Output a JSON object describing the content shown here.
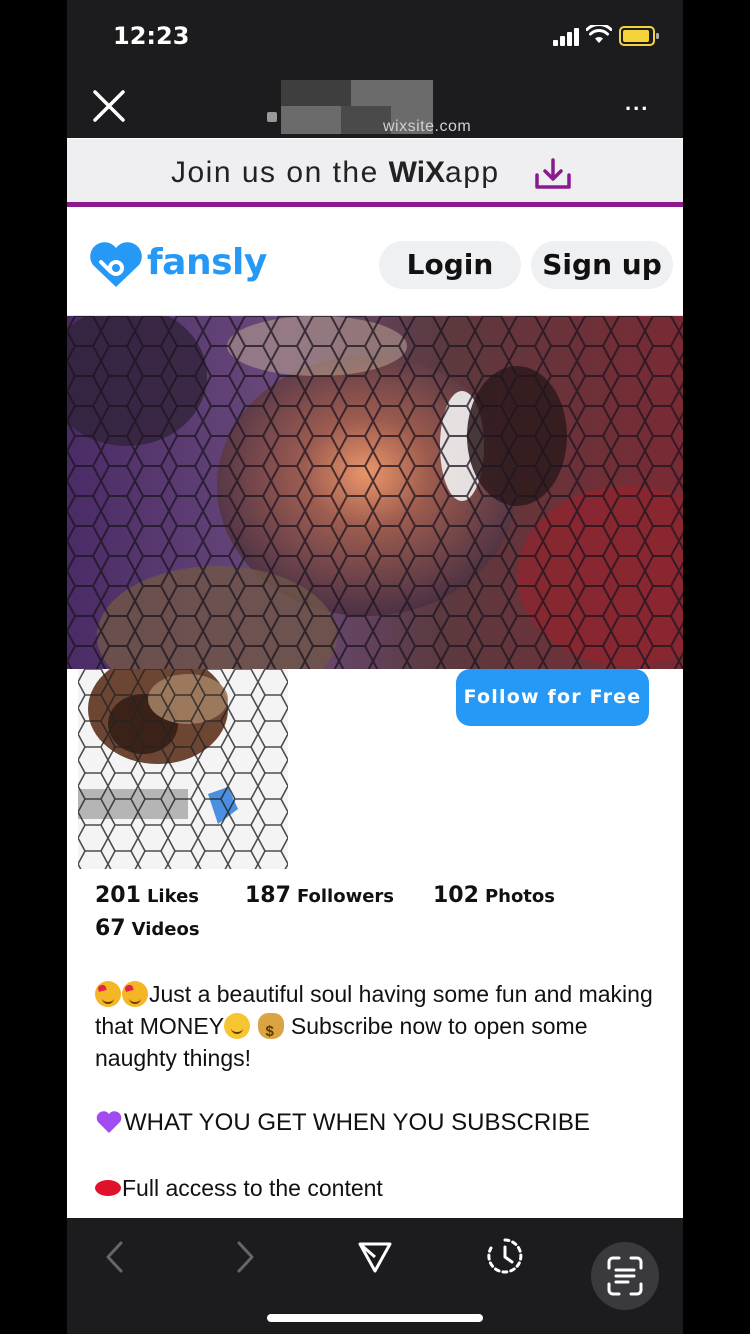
{
  "status_bar": {
    "time": "12:23"
  },
  "browser": {
    "url_domain": "wixsite.com",
    "more_label": "..."
  },
  "wix_banner": {
    "prefix": "Join us on the",
    "logo": "WiX",
    "suffix": "app"
  },
  "site_header": {
    "brand": "fansly",
    "login_label": "Login",
    "signup_label": "Sign up"
  },
  "profile": {
    "follow_label": "Follow for Free"
  },
  "stats": [
    {
      "value": "201",
      "label": "Likes"
    },
    {
      "value": "187",
      "label": "Followers"
    },
    {
      "value": "102",
      "label": "Photos"
    },
    {
      "value": "67",
      "label": "Videos"
    }
  ],
  "bio": {
    "line1": "Just a beautiful soul having some fun and making that MONEY",
    "line1b": " Subscribe now to open some naughty things!",
    "heading": "WHAT YOU GET WHEN YOU SUBSCRIBE",
    "item1": "Full access to the content"
  },
  "colors": {
    "brand_blue": "#2699f7",
    "wix_purple": "#8a1b8e",
    "chrome_dark": "#1c1c1e"
  },
  "icons": [
    "close-icon",
    "lock-icon",
    "download-icon",
    "fansly-logo-icon",
    "back-icon",
    "forward-icon",
    "share-icon",
    "history-icon",
    "scan-text-icon"
  ]
}
